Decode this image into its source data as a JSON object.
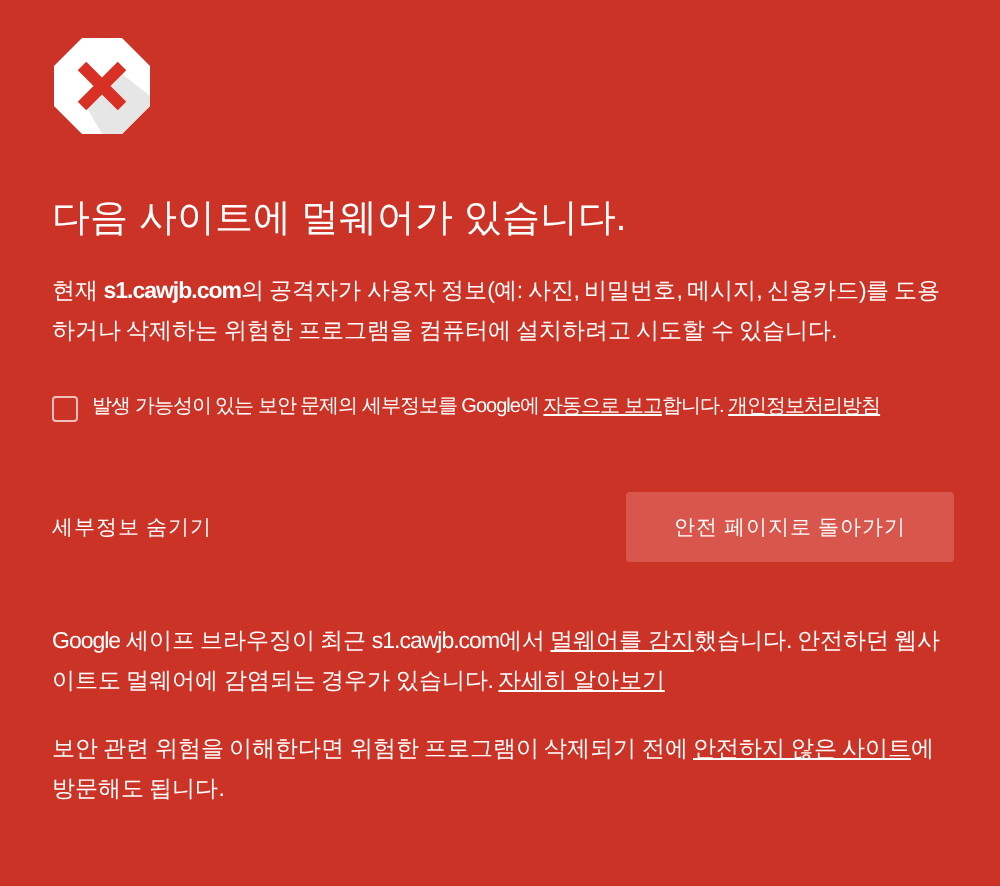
{
  "heading": "다음 사이트에 멀웨어가 있습니다.",
  "intro": [
    {
      "kind": "text",
      "text": "현재 "
    },
    {
      "kind": "bold",
      "text": "s1.cawjb.com"
    },
    {
      "kind": "text",
      "text": "의 공격자가 사용자 정보(예: 사진, 비밀번호, 메시지, 신용카드)를 도용하거나 삭제하는 위험한 프로그램을 컴퓨터에 설치하려고 시도할 수 있습니다."
    }
  ],
  "report": {
    "checked": false,
    "parts": [
      {
        "kind": "text",
        "text": "발생 가능성이 있는 보안 문제의 세부정보를 Google에 "
      },
      {
        "kind": "link",
        "text": "자동으로 보고"
      },
      {
        "kind": "text",
        "text": "합니다. "
      },
      {
        "kind": "link",
        "text": "개인정보처리방침"
      }
    ]
  },
  "details_toggle": "세부정보 숨기기",
  "back_button": "안전 페이지로 돌아가기",
  "details": [
    [
      {
        "kind": "text",
        "text": "Google 세이프 브라우징이 최근 s1.cawjb.com에서 "
      },
      {
        "kind": "link",
        "text": "멀웨어를 감지"
      },
      {
        "kind": "text",
        "text": "했습니다. 안전하던 웹사이트도 멀웨어에 감염되는 경우가 있습니다. "
      },
      {
        "kind": "link",
        "text": "자세히 알아보기"
      }
    ],
    [
      {
        "kind": "text",
        "text": "보안 관련 위험을 이해한다면 위험한 프로그램이 삭제되기 전에 "
      },
      {
        "kind": "link",
        "text": "안전하지 않은 사이트"
      },
      {
        "kind": "text",
        "text": "에 방문해도 됩니다."
      }
    ]
  ]
}
